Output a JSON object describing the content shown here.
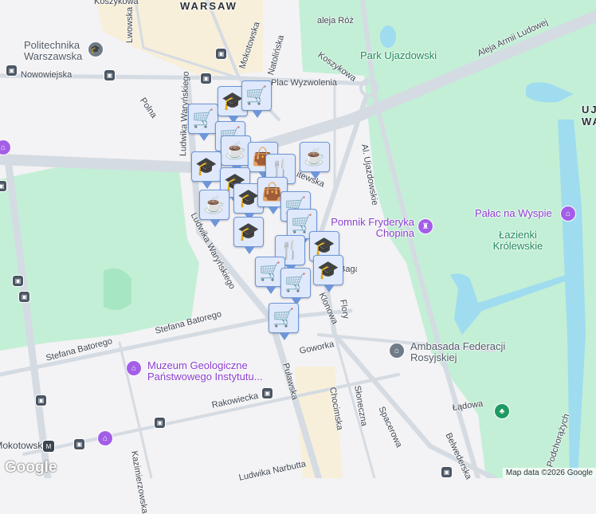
{
  "map": {
    "city_label": "WARSAW",
    "streets": [
      "Koszykowa",
      "Lwowska",
      "Mokotowska",
      "Natolińska",
      "aleja Róż",
      "Koszykowa",
      "Nowowiejska",
      "Polna",
      "Ludwika Waryńskiego",
      "Plac Wyzwolenia",
      "Litewska",
      "Al. Ujazdowskie",
      "Aleja Armii Ludowej",
      "Ludwika Waryńskiego",
      "Stefana Batorego",
      "Stefana Batorego",
      "Puławska",
      "Goworka",
      "Rakowiecka",
      "Kazimierzowska",
      "Chocimska",
      "Słoneczna",
      "Spacerowa",
      "Belwederska",
      "Łądowa",
      "Podchorążych",
      "Klonowa",
      "Flory",
      "Ludwika Narbutta",
      "Bagatela",
      "Belwederska"
    ],
    "places": {
      "politechnika": "Politechnika Warszawska",
      "park_ujazdowski": "Park Ujazdowski",
      "chopin": "Pomnik Fryderyka Chopina",
      "palac": "Pałac na Wyspie",
      "lazienki": "Łazienki Królewskie",
      "muzeum": "Muzeum Geologiczne Państwowego Instytutu...",
      "ambasada": "Ambasada Federacji Rosyjskiej",
      "ujazdow": "UJA WA",
      "metro": "Pole Mokotowskie"
    },
    "metro_icon": "M",
    "markers": [
      "cart",
      "graduation-cap",
      "cart",
      "cart",
      "coffee",
      "bag",
      "coffee",
      "fork-knife",
      "graduation-cap",
      "graduation-cap",
      "graduation-cap",
      "bag",
      "coffee",
      "graduation-cap",
      "cart",
      "cart",
      "fork-knife",
      "graduation-cap",
      "graduation-cap",
      "cart",
      "cart",
      "cart"
    ],
    "colors": {
      "marker_bg": "#dfe9fb",
      "marker_border": "#6e96d8",
      "marker_icon": "#0f4566",
      "park": "#c3efd6",
      "water": "#9fdcf0",
      "road": "#d5dbe2"
    }
  },
  "footer": {
    "logo": "Google",
    "attribution": "Map data ©2026 Google"
  }
}
